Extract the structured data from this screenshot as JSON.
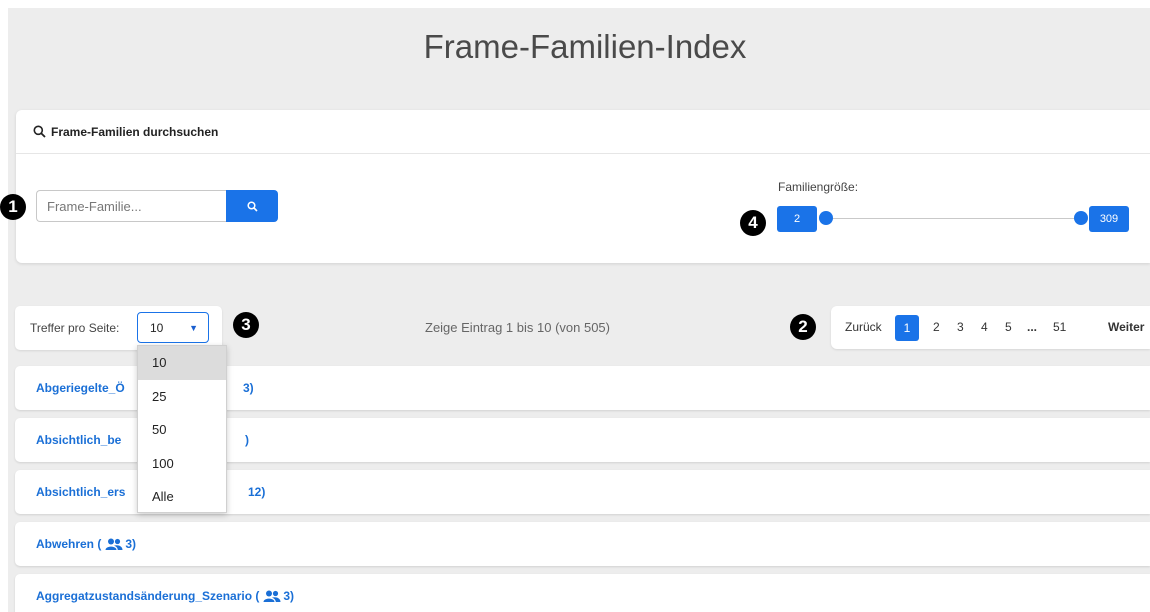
{
  "page_title": "Frame-Familien-Index",
  "search": {
    "header": "Frame-Familien durchsuchen",
    "placeholder": "Frame-Familie..."
  },
  "slider": {
    "label": "Familiengröße:",
    "min": "2",
    "max": "309"
  },
  "badges": [
    "1",
    "2",
    "3",
    "4"
  ],
  "per_page": {
    "label": "Treffer pro Seite:",
    "selected": "10",
    "options": [
      "10",
      "25",
      "50",
      "100",
      "Alle"
    ]
  },
  "entries_info": "Zeige Eintrag 1 bis 10 (von 505)",
  "pagination": {
    "prev": "Zurück",
    "pages": [
      "1",
      "2",
      "3",
      "4",
      "5"
    ],
    "ellipsis": "...",
    "last": "51",
    "next": "Weiter"
  },
  "rows": [
    {
      "prefix": "Abgeriegelte_Ö",
      "count": "3)"
    },
    {
      "prefix": "Absichtlich_be",
      "count": ")"
    },
    {
      "prefix": "Absichtlich_ers",
      "count": "12)"
    },
    {
      "prefix": "Abwehren (",
      "count": "3)"
    },
    {
      "prefix": "Aggregatzustandsänderung_Szenario (",
      "count": "3)"
    }
  ],
  "colors": {
    "accent": "#1a73e8",
    "link": "#1a6fd6",
    "background": "#ededed"
  },
  "icons": {
    "search": "search-icon",
    "family": "people-icon"
  }
}
